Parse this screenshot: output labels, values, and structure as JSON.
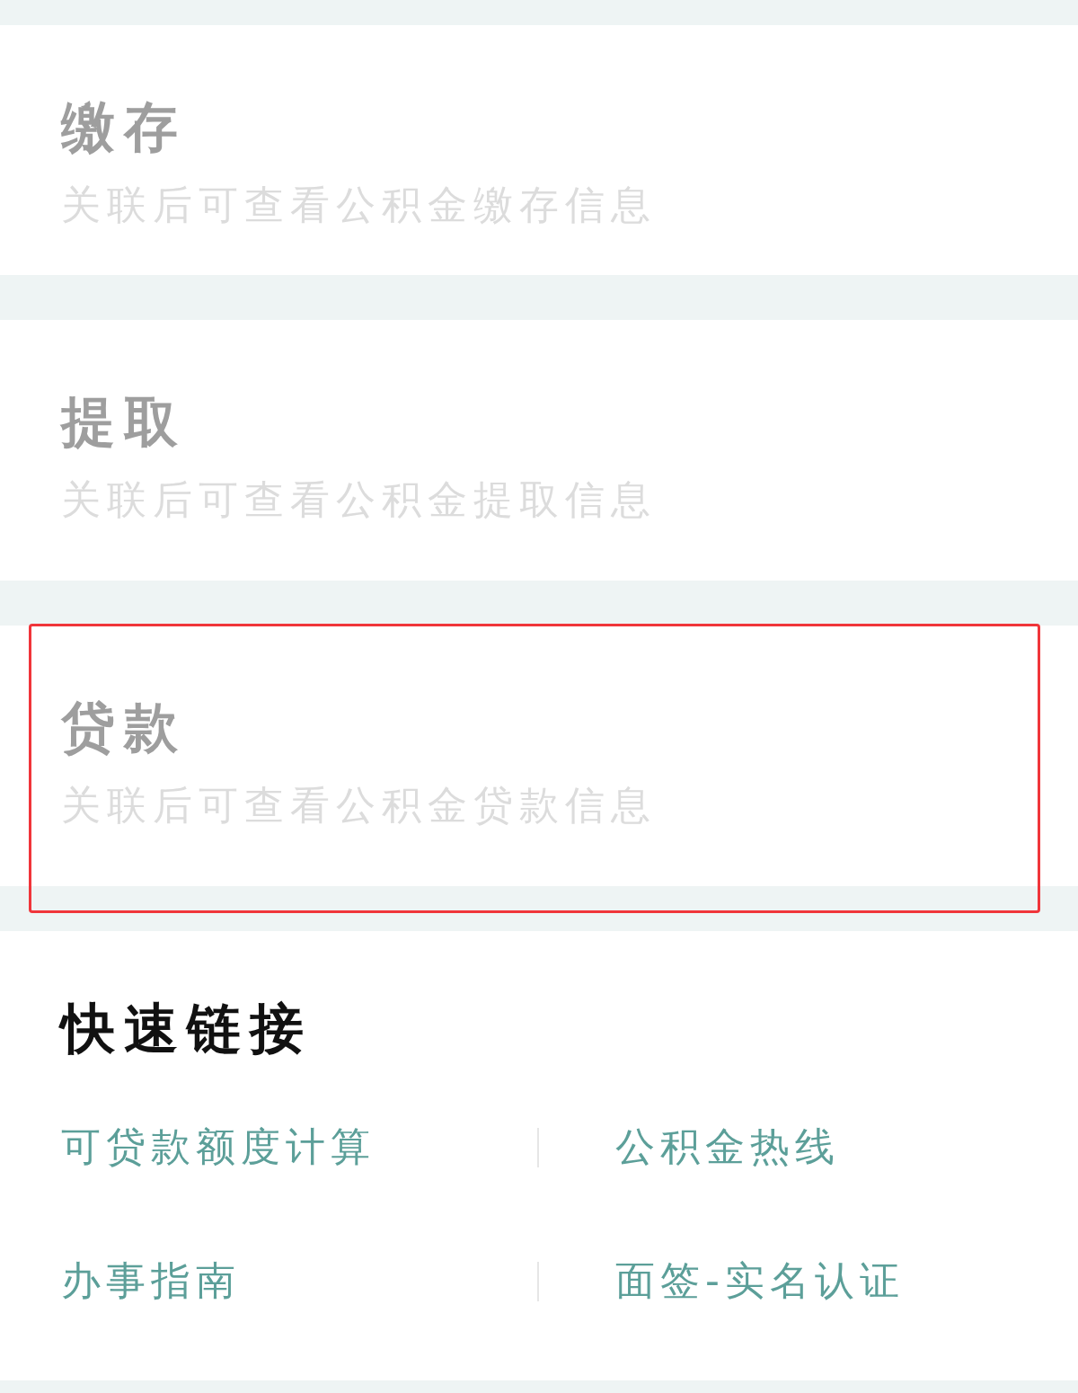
{
  "cards": [
    {
      "title": "缴存",
      "subtitle": "关联后可查看公积金缴存信息",
      "highlighted": false
    },
    {
      "title": "提取",
      "subtitle": "关联后可查看公积金提取信息",
      "highlighted": false
    },
    {
      "title": "贷款",
      "subtitle": "关联后可查看公积金贷款信息",
      "highlighted": true
    }
  ],
  "quick_links": {
    "title": "快速链接",
    "links": [
      "可贷款额度计算",
      "公积金热线",
      "办事指南",
      "面签-实名认证"
    ]
  }
}
